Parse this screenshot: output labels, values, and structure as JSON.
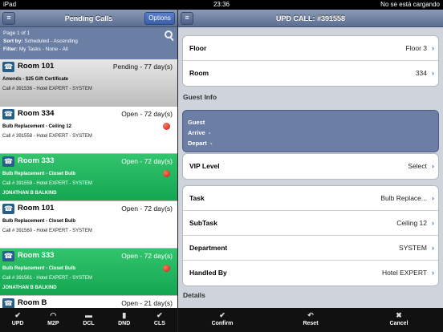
{
  "status": {
    "device": "iPad",
    "time": "23:36",
    "battery": "No se está cargando"
  },
  "left": {
    "title": "Pending Calls",
    "options_label": "Options",
    "info": {
      "page": "Page 1 of 1",
      "sort_label": "Sort by:",
      "sort_value": "Scheduled - Ascending",
      "filter_label": "Filter:",
      "filter_value": "My Tasks - None - All"
    },
    "calls": [
      {
        "room": "Room 101",
        "status": "Pending - 77 day(s)",
        "task": "Amends - $25 Gift Certificate",
        "sub": "Call # 391536 - Hotel EXPERT - SYSTEM",
        "person": ""
      },
      {
        "room": "Room 334",
        "status": "Open - 72 day(s)",
        "task": "Bulb Replacement - Ceiling 12",
        "sub": "Call # 391558 - Hotel EXPERT - SYSTEM",
        "person": ""
      },
      {
        "room": "Room 333",
        "status": "Open - 72 day(s)",
        "task": "Bulb Replacement - Closet Bulb",
        "sub": "Call # 391559 - Hotel EXPERT - SYSTEM",
        "person": "JONATHAN B BALKIND"
      },
      {
        "room": "Room 101",
        "status": "Open - 72 day(s)",
        "task": "Bulb Replacement - Closet Bulb",
        "sub": "Call # 391560 - Hotel EXPERT - SYSTEM",
        "person": ""
      },
      {
        "room": "Room 333",
        "status": "Open - 72 day(s)",
        "task": "Bulb Replacement - Closet Bulb",
        "sub": "Call # 391561 - Hotel EXPERT - SYSTEM",
        "person": "JONATHAN B BALKIND"
      },
      {
        "room": "Room B",
        "status": "Open - 21 day(s)",
        "task": "",
        "sub": "",
        "person": ""
      }
    ],
    "tabs": [
      {
        "icon": "✔",
        "label": "UPD"
      },
      {
        "icon": "◠",
        "label": "M2P"
      },
      {
        "icon": "▬",
        "label": "DCL"
      },
      {
        "icon": "▮",
        "label": "DND"
      },
      {
        "icon": "✔",
        "label": "CLS"
      }
    ]
  },
  "right": {
    "title": "UPD CALL: #391558",
    "floor": {
      "label": "Floor",
      "value": "Floor 3"
    },
    "room": {
      "label": "Room",
      "value": "334"
    },
    "guest_info_header": "Guest Info",
    "guest": {
      "guest_label": "Guest",
      "arrive_label": "Arrive",
      "arrive_value": "-",
      "depart_label": "Depart",
      "depart_value": "-"
    },
    "vip": {
      "label": "VIP Level",
      "value": "Select"
    },
    "task": {
      "label": "Task",
      "value": "Bulb Replace..."
    },
    "subtask": {
      "label": "SubTask",
      "value": "Ceiling 12"
    },
    "department": {
      "label": "Department",
      "value": "SYSTEM"
    },
    "handled": {
      "label": "Handled By",
      "value": "Hotel EXPERT"
    },
    "details_header": "Details",
    "tabs": [
      {
        "icon": "✔",
        "label": "Confirm"
      },
      {
        "icon": "↶",
        "label": "Reset"
      },
      {
        "icon": "✖",
        "label": "Cancel"
      }
    ]
  }
}
